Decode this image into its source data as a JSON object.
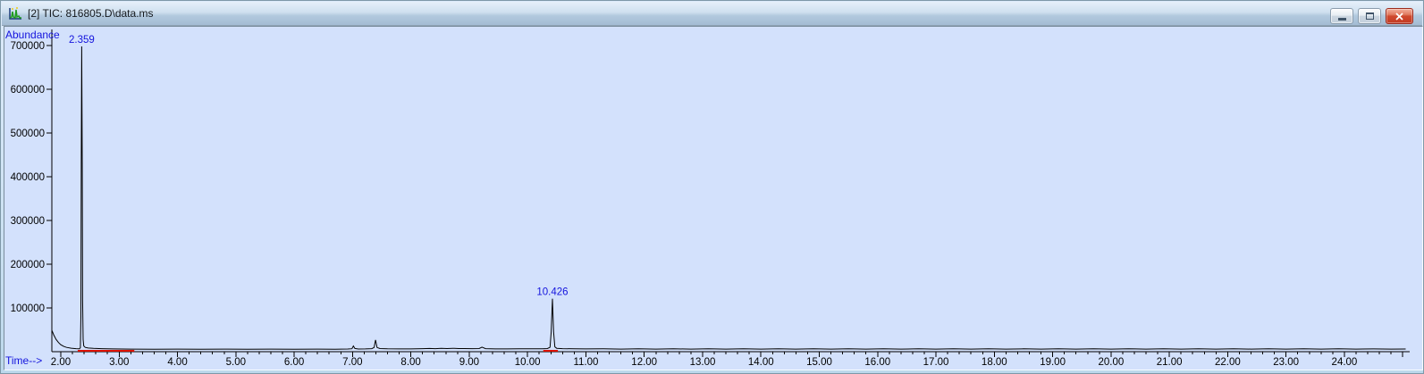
{
  "window": {
    "title": "[2] TIC: 816805.D\\data.ms",
    "icon": "chromatogram-document-icon",
    "controls": {
      "minimize_label": "minimize",
      "maximize_label": "maximize",
      "close_label": "close"
    }
  },
  "colors": {
    "plot_background": "#d3e1fc",
    "trace": "#000000",
    "axis": "#000000",
    "annotation_blue": "#1414dd",
    "integration_red": "#dd1100",
    "titlebar_gradient_top": "#e6f0fa",
    "titlebar_gradient_bottom": "#a4bcd4",
    "close_button_red": "#c23a22"
  },
  "chart_data": {
    "type": "line",
    "title": "TIC: 816805.D\\data.ms",
    "xlabel": "Time-->",
    "ylabel": "Abundance",
    "xlim": [
      1.85,
      25.12
    ],
    "ylim": [
      0,
      730000
    ],
    "x_major_tick_step": 1.0,
    "x_minor_tick_step": 0.2,
    "grid": false,
    "x_ticks": [
      {
        "v": 2,
        "label": "2.00"
      },
      {
        "v": 3,
        "label": "3.00"
      },
      {
        "v": 4,
        "label": "4.00"
      },
      {
        "v": 5,
        "label": "5.00"
      },
      {
        "v": 6,
        "label": "6.00"
      },
      {
        "v": 7,
        "label": "7.00"
      },
      {
        "v": 8,
        "label": "8.00"
      },
      {
        "v": 9,
        "label": "9.00"
      },
      {
        "v": 10,
        "label": "10.00"
      },
      {
        "v": 11,
        "label": "11.00"
      },
      {
        "v": 12,
        "label": "12.00"
      },
      {
        "v": 13,
        "label": "13.00"
      },
      {
        "v": 14,
        "label": "14.00"
      },
      {
        "v": 15,
        "label": "15.00"
      },
      {
        "v": 16,
        "label": "16.00"
      },
      {
        "v": 17,
        "label": "17.00"
      },
      {
        "v": 18,
        "label": "18.00"
      },
      {
        "v": 19,
        "label": "19.00"
      },
      {
        "v": 20,
        "label": "20.00"
      },
      {
        "v": 21,
        "label": "21.00"
      },
      {
        "v": 22,
        "label": "22.00"
      },
      {
        "v": 23,
        "label": "23.00"
      },
      {
        "v": 24,
        "label": "24.00"
      },
      {
        "v": 25,
        "label": ""
      }
    ],
    "y_ticks": [
      {
        "v": 100000,
        "label": "100000"
      },
      {
        "v": 200000,
        "label": "200000"
      },
      {
        "v": 300000,
        "label": "300000"
      },
      {
        "v": 400000,
        "label": "400000"
      },
      {
        "v": 500000,
        "label": "500000"
      },
      {
        "v": 600000,
        "label": "600000"
      },
      {
        "v": 700000,
        "label": "700000"
      }
    ],
    "labeled_peaks": [
      {
        "rt": 2.359,
        "label": "2.359",
        "apex_abundance": 698000
      },
      {
        "rt": 10.426,
        "label": "10.426",
        "apex_abundance": 121000
      }
    ],
    "minor_peaks": [
      {
        "rt": 7.02,
        "apex_abundance": 13000
      },
      {
        "rt": 7.4,
        "apex_abundance": 27000
      },
      {
        "rt": 9.22,
        "apex_abundance": 10500
      }
    ],
    "integration_segments": [
      {
        "from": 2.29,
        "to": 3.26
      },
      {
        "from": 10.27,
        "to": 10.52
      }
    ],
    "baseline_level": 6000,
    "trace": [
      [
        1.85,
        48000
      ],
      [
        1.88,
        38000
      ],
      [
        1.92,
        28000
      ],
      [
        1.96,
        21000
      ],
      [
        2.0,
        16000
      ],
      [
        2.05,
        12000
      ],
      [
        2.1,
        9800
      ],
      [
        2.18,
        8000
      ],
      [
        2.26,
        7000
      ],
      [
        2.32,
        6800
      ],
      [
        2.335,
        9000
      ],
      [
        2.344,
        80000
      ],
      [
        2.351,
        430000
      ],
      [
        2.359,
        698000
      ],
      [
        2.367,
        430000
      ],
      [
        2.374,
        120000
      ],
      [
        2.383,
        28000
      ],
      [
        2.393,
        13000
      ],
      [
        2.42,
        9800
      ],
      [
        2.47,
        8400
      ],
      [
        2.56,
        7600
      ],
      [
        2.7,
        6900
      ],
      [
        2.9,
        6400
      ],
      [
        3.2,
        6000
      ],
      [
        3.6,
        5800
      ],
      [
        4.0,
        5900
      ],
      [
        4.4,
        5700
      ],
      [
        4.8,
        5900
      ],
      [
        5.2,
        5700
      ],
      [
        5.6,
        5900
      ],
      [
        6.0,
        5700
      ],
      [
        6.4,
        5900
      ],
      [
        6.7,
        5800
      ],
      [
        6.92,
        6100
      ],
      [
        6.99,
        6800
      ],
      [
        7.015,
        13000
      ],
      [
        7.04,
        7400
      ],
      [
        7.1,
        6200
      ],
      [
        7.22,
        6400
      ],
      [
        7.33,
        7000
      ],
      [
        7.37,
        9500
      ],
      [
        7.395,
        27000
      ],
      [
        7.42,
        9500
      ],
      [
        7.47,
        7200
      ],
      [
        7.6,
        6500
      ],
      [
        7.8,
        6300
      ],
      [
        8.0,
        6400
      ],
      [
        8.2,
        6900
      ],
      [
        8.32,
        7300
      ],
      [
        8.42,
        6900
      ],
      [
        8.52,
        7500
      ],
      [
        8.62,
        7100
      ],
      [
        8.72,
        7700
      ],
      [
        8.82,
        7200
      ],
      [
        8.92,
        7100
      ],
      [
        9.05,
        6900
      ],
      [
        9.17,
        7100
      ],
      [
        9.22,
        10500
      ],
      [
        9.28,
        6900
      ],
      [
        9.45,
        6400
      ],
      [
        9.65,
        6300
      ],
      [
        9.85,
        6500
      ],
      [
        10.05,
        6500
      ],
      [
        10.25,
        6700
      ],
      [
        10.34,
        7200
      ],
      [
        10.385,
        10000
      ],
      [
        10.405,
        45000
      ],
      [
        10.426,
        121000
      ],
      [
        10.447,
        45000
      ],
      [
        10.468,
        11000
      ],
      [
        10.5,
        7800
      ],
      [
        10.6,
        6900
      ],
      [
        10.8,
        6500
      ],
      [
        11.0,
        6300
      ],
      [
        11.3,
        6500
      ],
      [
        11.6,
        5900
      ],
      [
        11.9,
        6500
      ],
      [
        12.2,
        5900
      ],
      [
        12.5,
        6500
      ],
      [
        12.8,
        5900
      ],
      [
        13.1,
        6500
      ],
      [
        13.4,
        5900
      ],
      [
        13.7,
        6500
      ],
      [
        14.0,
        5900
      ],
      [
        14.3,
        6500
      ],
      [
        14.6,
        5900
      ],
      [
        14.9,
        6500
      ],
      [
        15.2,
        5900
      ],
      [
        15.5,
        6500
      ],
      [
        15.8,
        5900
      ],
      [
        16.1,
        6500
      ],
      [
        16.4,
        5900
      ],
      [
        16.7,
        6500
      ],
      [
        17.0,
        5900
      ],
      [
        17.3,
        6500
      ],
      [
        17.6,
        5900
      ],
      [
        17.9,
        6500
      ],
      [
        18.2,
        5900
      ],
      [
        18.5,
        6500
      ],
      [
        18.8,
        5900
      ],
      [
        19.1,
        6500
      ],
      [
        19.4,
        5900
      ],
      [
        19.7,
        6500
      ],
      [
        20.0,
        5900
      ],
      [
        20.3,
        6500
      ],
      [
        20.6,
        5900
      ],
      [
        20.9,
        6500
      ],
      [
        21.2,
        5900
      ],
      [
        21.5,
        6500
      ],
      [
        21.8,
        5900
      ],
      [
        22.1,
        6500
      ],
      [
        22.4,
        5900
      ],
      [
        22.7,
        6500
      ],
      [
        23.0,
        5900
      ],
      [
        23.3,
        6500
      ],
      [
        23.6,
        5900
      ],
      [
        23.9,
        6500
      ],
      [
        24.2,
        5900
      ],
      [
        24.5,
        6400
      ],
      [
        24.8,
        6000
      ],
      [
        25.05,
        6100
      ]
    ]
  }
}
